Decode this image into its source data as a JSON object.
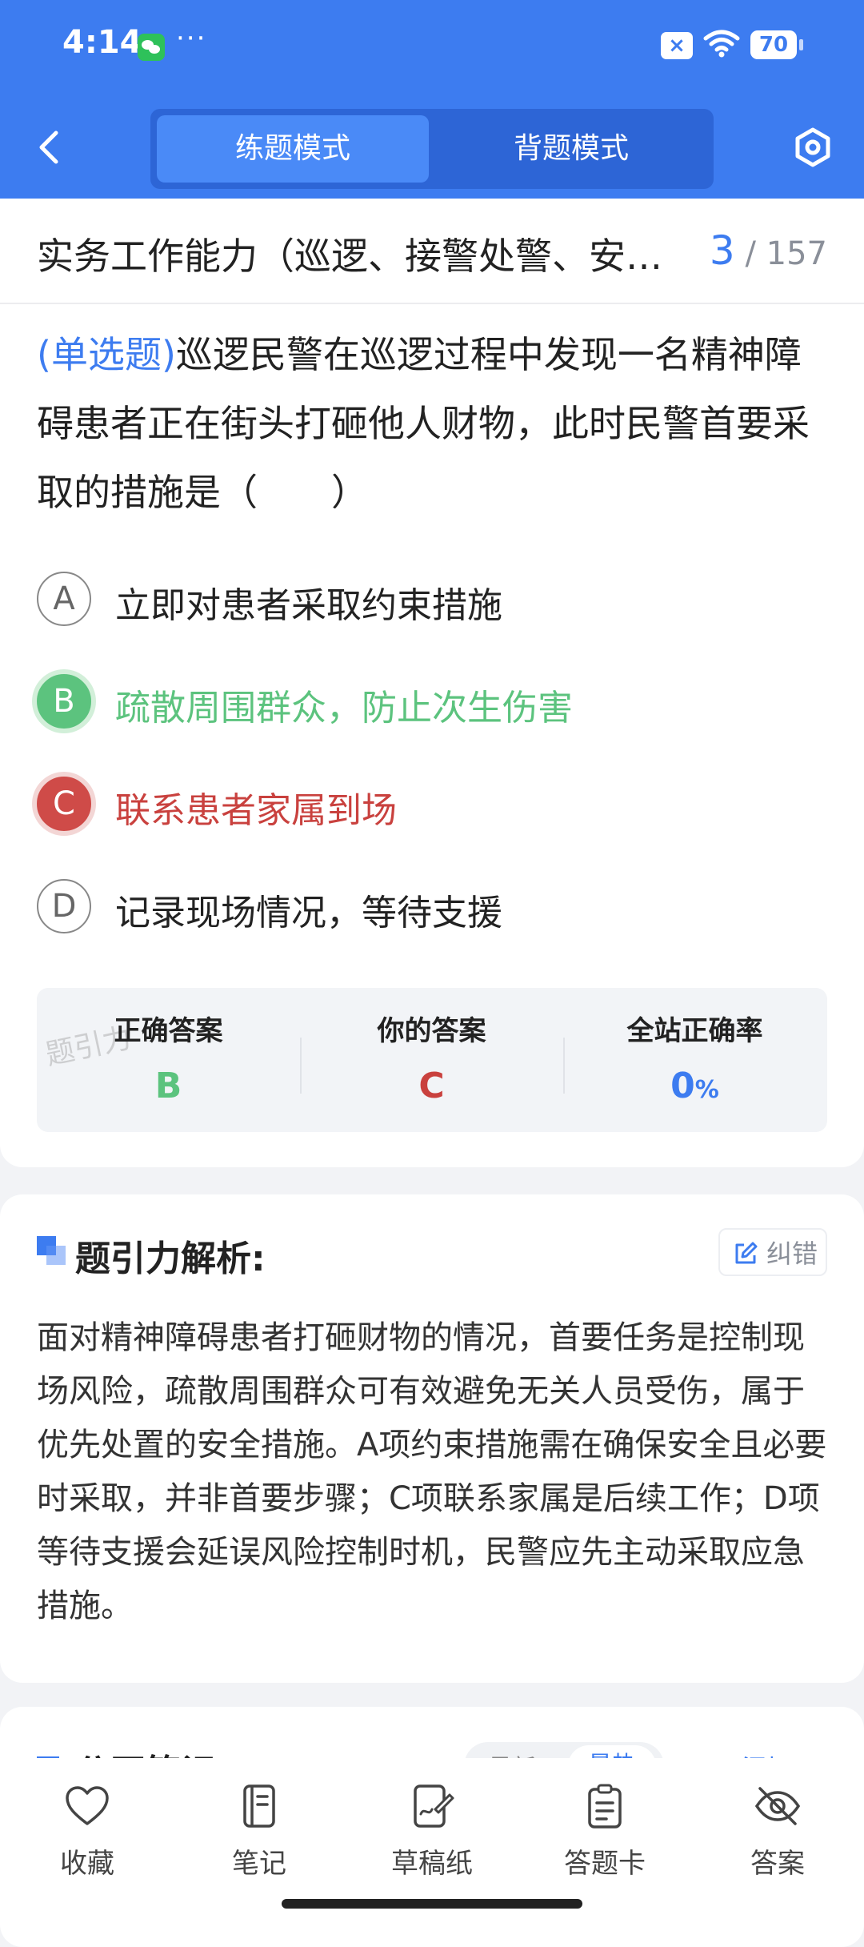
{
  "status_bar": {
    "time": "4:14",
    "dots": "···",
    "battery": "70"
  },
  "header": {
    "tabs": [
      "练题模式",
      "背题模式"
    ],
    "active_tab": 0
  },
  "question": {
    "category": "实务工作能力（巡逻、接警处警、安…",
    "current": "3",
    "total": "157",
    "type_tag": "(单选题)",
    "text": "巡逻民警在巡逻过程中发现一名精神障碍患者正在街头打砸他人财物，此时民警首要采取的措施是（　　）",
    "options": [
      {
        "letter": "A",
        "text": "立即对患者采取约束措施",
        "state": "normal"
      },
      {
        "letter": "B",
        "text": "疏散周围群众，防止次生伤害",
        "state": "correct"
      },
      {
        "letter": "C",
        "text": "联系患者家属到场",
        "state": "wrong"
      },
      {
        "letter": "D",
        "text": "记录现场情况，等待支援",
        "state": "normal"
      }
    ]
  },
  "result": {
    "correct_label": "正确答案",
    "correct_value": "B",
    "yours_label": "你的答案",
    "yours_value": "C",
    "rate_label": "全站正确率",
    "rate_value": "0",
    "rate_unit": "%",
    "watermark": "题引力"
  },
  "analysis": {
    "title": "题引力解析:",
    "fix_label": "纠错",
    "body": "面对精神障碍患者打砸财物的情况，首要任务是控制现场风险，疏散周围群众可有效避免无关人员受伤，属于优先处置的安全措施。A项约束措施需在确保安全且必要时采取，并非首要步骤；C项联系家属是后续工作；D项等待支援会延误风险控制时机，民警应先主动采取应急措施。"
  },
  "notes": {
    "title": "公开笔记：",
    "sort_latest": "最新",
    "sort_hot": "最热",
    "add_label": "添加"
  },
  "bottom_nav": [
    {
      "label": "收藏",
      "icon": "heart-icon"
    },
    {
      "label": "笔记",
      "icon": "notebook-icon"
    },
    {
      "label": "草稿纸",
      "icon": "draft-paper-icon"
    },
    {
      "label": "答题卡",
      "icon": "answer-card-icon"
    },
    {
      "label": "答案",
      "icon": "eye-off-icon"
    }
  ],
  "colors": {
    "primary": "#3d7cf0",
    "correct": "#5cc37e",
    "wrong": "#c9413e"
  }
}
